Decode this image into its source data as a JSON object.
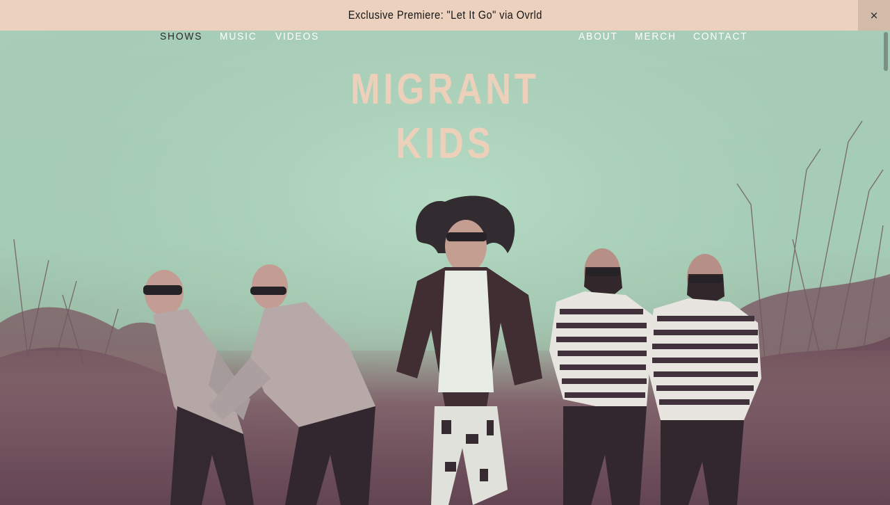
{
  "announcement": {
    "text": "Exclusive Premiere: \"Let It Go\" via Ovrld",
    "close_icon": "×"
  },
  "nav": {
    "left": [
      {
        "label": "SHOWS"
      },
      {
        "label": "MUSIC"
      },
      {
        "label": "VIDEOS"
      }
    ],
    "right": [
      {
        "label": "ABOUT"
      },
      {
        "label": "MERCH"
      },
      {
        "label": "CONTACT"
      }
    ]
  },
  "logo": {
    "line1": "MIGRANT",
    "line2": "KIDS"
  },
  "colors": {
    "announcement_bg": "#ecd2be",
    "logo": "#ecd0ba",
    "sky": "#a9cdb8",
    "brush": "#6b4655"
  }
}
